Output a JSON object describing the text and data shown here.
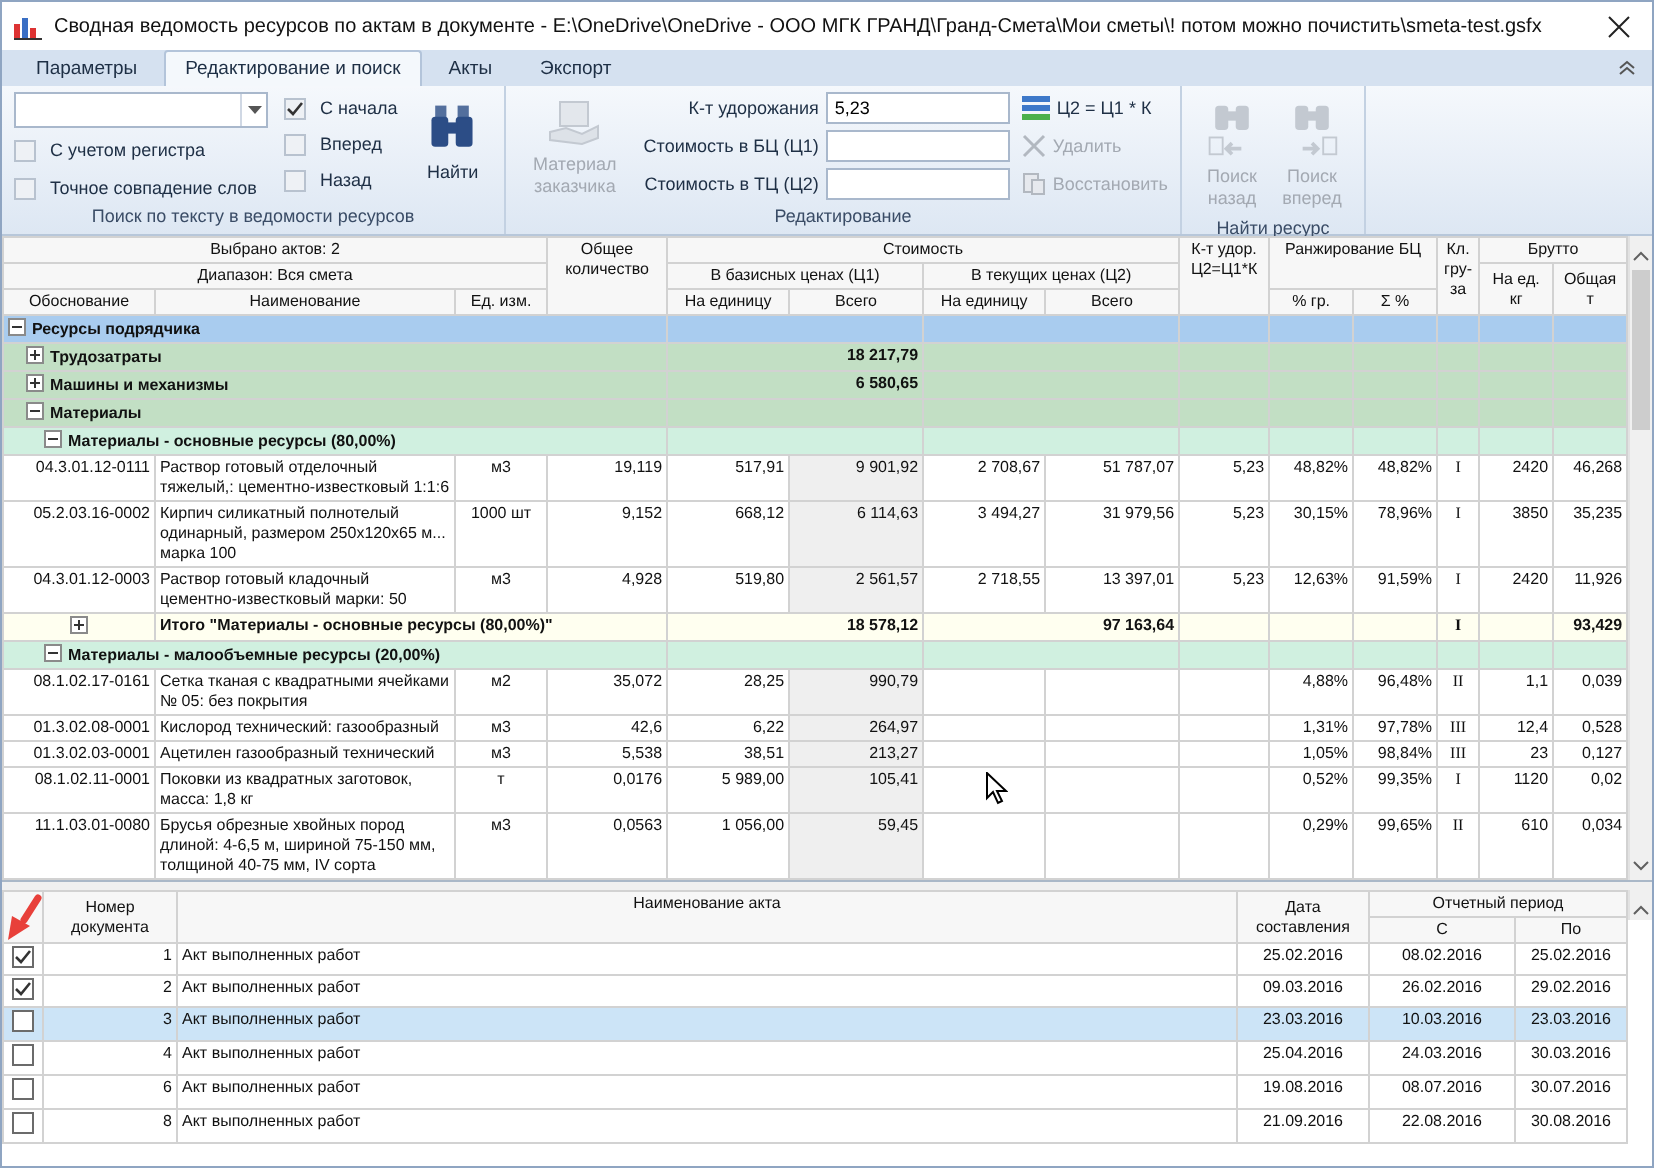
{
  "window": {
    "title": "Сводная ведомость ресурсов по актам в документе - E:\\OneDrive\\OneDrive - ООО МГК ГРАНД\\Гранд-Смета\\Мои сметы\\! потом можно почистить\\smeta-test.gsfx"
  },
  "tabs": [
    {
      "label": "Параметры",
      "selected": false
    },
    {
      "label": "Редактирование и поиск",
      "selected": true
    },
    {
      "label": "Акты",
      "selected": false
    },
    {
      "label": "Экспорт",
      "selected": false
    }
  ],
  "ribbon": {
    "search": {
      "caption": "Поиск по тексту в ведомости ресурсов",
      "options": [
        {
          "label": "С учетом регистра",
          "checked": false
        },
        {
          "label": "Точное совпадение слов",
          "checked": false
        }
      ],
      "direction": [
        {
          "label": "С начала",
          "checked": true
        },
        {
          "label": "Вперед",
          "checked": false
        },
        {
          "label": "Назад",
          "checked": false
        }
      ],
      "find_button": "Найти"
    },
    "editing": {
      "caption": "Редактирование",
      "customer_material": {
        "label": "Материал заказчика",
        "disabled": true
      },
      "fields": [
        {
          "label": "К-т удорожания",
          "value": "5,23"
        },
        {
          "label": "Стоимость в БЦ (Ц1)"
        },
        {
          "label": "Стоимость в ТЦ (Ц2)"
        }
      ],
      "actions": [
        {
          "kind": "formula",
          "label": "Ц2 = Ц1 * К",
          "disabled": false
        },
        {
          "kind": "delete",
          "label": "Удалить",
          "disabled": true
        },
        {
          "kind": "restore",
          "label": "Восстановить",
          "disabled": true
        }
      ]
    },
    "find_resource": {
      "caption": "Найти ресурс",
      "buttons": [
        {
          "kind": "back",
          "label": "Поиск назад",
          "disabled": true
        },
        {
          "kind": "forward",
          "label": "Поиск вперед",
          "disabled": true
        }
      ]
    }
  },
  "grid": {
    "header": {
      "selected_acts": "Выбрано актов: 2",
      "range": "Диапазон: Вся смета",
      "code": "Обоснование",
      "name": "Наименование",
      "unit": "Ед. изм.",
      "quantity": "Общее количество",
      "cost": "Стоимость",
      "base_prices": "В базисных ценах (Ц1)",
      "current_prices": "В текущих ценах (Ц2)",
      "per_unit_base": "На единицу",
      "total_base": "Всего",
      "per_unit_current": "На единицу",
      "total_current": "Всего",
      "coefficient": "К-т удор. Ц2=Ц1*К",
      "ranking": "Ранжирование БЦ",
      "share": "% гр.",
      "cumulative": "Σ %",
      "cargo_class": "Кл. гру-за",
      "gross": "Брутто",
      "gross_unit": "На ед. кг",
      "gross_total": "Общая т"
    },
    "rows": [
      {
        "kind": "group",
        "label": "Ресурсы подрядчика",
        "expanded": true,
        "children": [
          {
            "kind": "group",
            "label": "Трудозатраты",
            "expanded": false,
            "bc_total": "18 217,79"
          },
          {
            "kind": "group",
            "label": "Машины и механизмы",
            "expanded": false,
            "bc_total": "6 580,65"
          },
          {
            "kind": "group",
            "label": "Материалы",
            "expanded": true,
            "children": [
              {
                "kind": "group",
                "label": "Материалы - основные ресурсы (80,00%)",
                "expanded": true,
                "children": [
                  {
                    "kind": "resource",
                    "code": "04.3.01.12-0111",
                    "name": "Раствор готовый отделочный тяжелый,: цементно-известковый 1:1:6",
                    "unit": "м3",
                    "qty": "19,119",
                    "bc_unit": "517,91",
                    "bc_total": "9 901,92",
                    "tc_unit": "2 708,67",
                    "tc_total": "51 787,07",
                    "k": "5,23",
                    "pct": "48,82%",
                    "cum": "48,82%",
                    "cls": "I",
                    "gross_unit": "2420",
                    "gross_total": "46,268"
                  },
                  {
                    "kind": "resource",
                    "code": "05.2.03.16-0002",
                    "name": "Кирпич силикатный полнотелый одинарный, размером 250х120х65 м... марка 100",
                    "unit": "1000 шт",
                    "qty": "9,152",
                    "bc_unit": "668,12",
                    "bc_total": "6 114,63",
                    "tc_unit": "3 494,27",
                    "tc_total": "31 979,56",
                    "k": "5,23",
                    "pct": "30,15%",
                    "cum": "78,96%",
                    "cls": "I",
                    "gross_unit": "3850",
                    "gross_total": "35,235"
                  },
                  {
                    "kind": "resource",
                    "code": "04.3.01.12-0003",
                    "name": "Раствор готовый кладочный цементно-известковый марки: 50",
                    "unit": "м3",
                    "qty": "4,928",
                    "bc_unit": "519,80",
                    "bc_total": "2 561,57",
                    "tc_unit": "2 718,55",
                    "tc_total": "13 397,01",
                    "k": "5,23",
                    "pct": "12,63%",
                    "cum": "91,59%",
                    "cls": "I",
                    "gross_unit": "2420",
                    "gross_total": "11,926"
                  },
                  {
                    "kind": "total",
                    "label": "Итого \"Материалы - основные ресурсы (80,00%)\"",
                    "expanded": false,
                    "bc_total": "18 578,12",
                    "tc_total": "97 163,64",
                    "cls": "I",
                    "gross_total": "93,429"
                  }
                ]
              },
              {
                "kind": "group",
                "label": "Материалы - малообъемные ресурсы (20,00%)",
                "expanded": true,
                "children": [
                  {
                    "kind": "resource",
                    "code": "08.1.02.17-0161",
                    "name": "Сетка тканая с квадратными ячейками № 05: без покрытия",
                    "unit": "м2",
                    "qty": "35,072",
                    "bc_unit": "28,25",
                    "bc_total": "990,79",
                    "pct": "4,88%",
                    "cum": "96,48%",
                    "cls": "II",
                    "gross_unit": "1,1",
                    "gross_total": "0,039"
                  },
                  {
                    "kind": "resource",
                    "code": "01.3.02.08-0001",
                    "name": "Кислород технический: газообразный",
                    "unit": "м3",
                    "qty": "42,6",
                    "bc_unit": "6,22",
                    "bc_total": "264,97",
                    "pct": "1,31%",
                    "cum": "97,78%",
                    "cls": "III",
                    "gross_unit": "12,4",
                    "gross_total": "0,528"
                  },
                  {
                    "kind": "resource",
                    "code": "01.3.02.03-0001",
                    "name": "Ацетилен газообразный технический",
                    "unit": "м3",
                    "qty": "5,538",
                    "bc_unit": "38,51",
                    "bc_total": "213,27",
                    "pct": "1,05%",
                    "cum": "98,84%",
                    "cls": "III",
                    "gross_unit": "23",
                    "gross_total": "0,127"
                  },
                  {
                    "kind": "resource",
                    "code": "08.1.02.11-0001",
                    "name": "Поковки из квадратных заготовок, масса: 1,8 кг",
                    "unit": "т",
                    "qty": "0,0176",
                    "bc_unit": "5 989,00",
                    "bc_total": "105,41",
                    "pct": "0,52%",
                    "cum": "99,35%",
                    "cls": "I",
                    "gross_unit": "1120",
                    "gross_total": "0,02"
                  },
                  {
                    "kind": "resource",
                    "code": "11.1.03.01-0080",
                    "name": "Брусья обрезные хвойных пород длиной: 4-6,5 м, шириной 75-150 мм, толщиной 40-75 мм, IV сорта",
                    "unit": "м3",
                    "qty": "0,0563",
                    "bc_unit": "1 056,00",
                    "bc_total": "59,45",
                    "pct": "0,29%",
                    "cum": "99,65%",
                    "cls": "II",
                    "gross_unit": "610",
                    "gross_total": "0,034"
                  }
                ]
              }
            ]
          }
        ]
      }
    ]
  },
  "acts": {
    "columns": {
      "number": "Номер документа",
      "name": "Наименование акта",
      "date": "Дата составления",
      "period": "Отчетный период",
      "from": "С",
      "to": "По"
    },
    "rows": [
      {
        "checked": true,
        "selected": false,
        "number": "1",
        "name": "Акт выполненных работ",
        "date": "25.02.2016",
        "from": "08.02.2016",
        "to": "25.02.2016"
      },
      {
        "checked": true,
        "selected": false,
        "number": "2",
        "name": "Акт выполненных работ",
        "date": "09.03.2016",
        "from": "26.02.2016",
        "to": "29.02.2016"
      },
      {
        "checked": false,
        "selected": true,
        "number": "3",
        "name": "Акт выполненных работ",
        "date": "23.03.2016",
        "from": "10.03.2016",
        "to": "23.03.2016"
      },
      {
        "checked": false,
        "selected": false,
        "number": "4",
        "name": "Акт выполненных работ",
        "date": "25.04.2016",
        "from": "24.03.2016",
        "to": "30.03.2016"
      },
      {
        "checked": false,
        "selected": false,
        "number": "6",
        "name": "Акт выполненных работ",
        "date": "19.08.2016",
        "from": "08.07.2016",
        "to": "30.07.2016"
      },
      {
        "checked": false,
        "selected": false,
        "number": "8",
        "name": "Акт выполненных работ",
        "date": "21.09.2016",
        "from": "22.08.2016",
        "to": "30.08.2016"
      }
    ]
  }
}
